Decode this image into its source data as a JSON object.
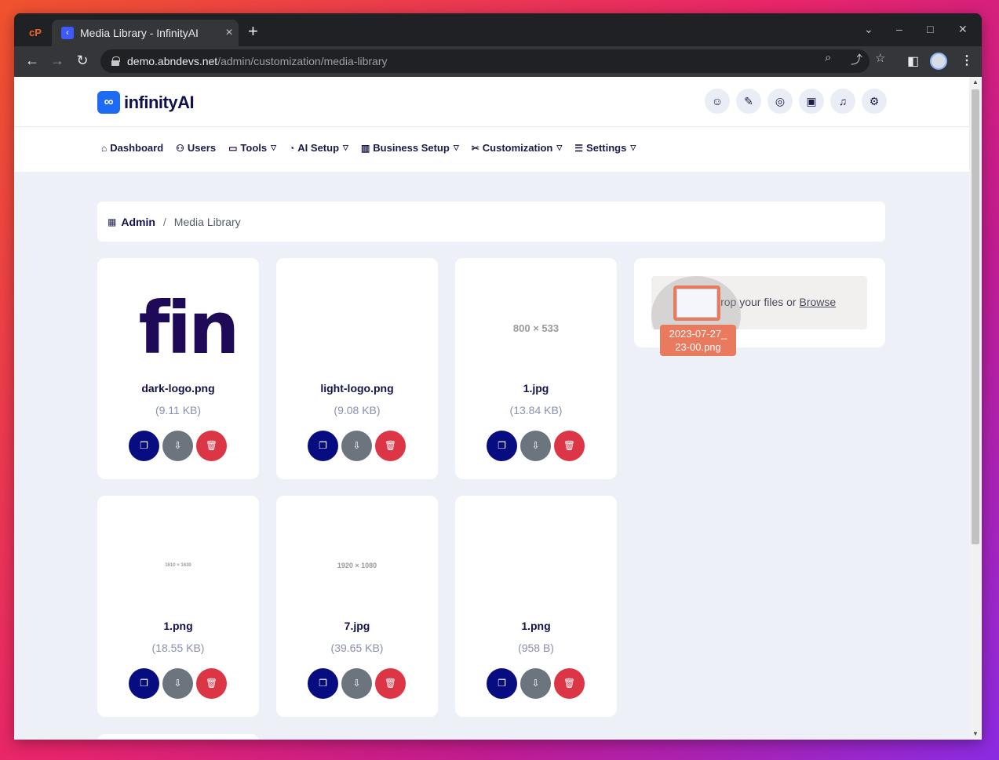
{
  "browser": {
    "tab_title": "Media Library - InfinityAI",
    "url_host": "demo.abndevs.net",
    "url_path": "/admin/customization/media-library"
  },
  "site": {
    "brand": "infinityAI",
    "header_icons": [
      "user-icon",
      "brush-icon",
      "globe-icon",
      "id-card-icon",
      "bell-icon",
      "user-settings-icon"
    ]
  },
  "nav": {
    "items": [
      {
        "label": "Dashboard",
        "icon": "home-icon",
        "dropdown": false
      },
      {
        "label": "Users",
        "icon": "users-icon",
        "dropdown": false
      },
      {
        "label": "Tools",
        "icon": "briefcase-icon",
        "dropdown": true
      },
      {
        "label": "AI Setup",
        "icon": "gauge-icon",
        "dropdown": true
      },
      {
        "label": "Business Setup",
        "icon": "building-icon",
        "dropdown": true
      },
      {
        "label": "Customization",
        "icon": "tools-icon",
        "dropdown": true
      },
      {
        "label": "Settings",
        "icon": "sliders-icon",
        "dropdown": true
      }
    ]
  },
  "breadcrumb": {
    "root": "Admin",
    "separator": "/",
    "current": "Media Library"
  },
  "media": [
    {
      "name": "dark-logo.png",
      "size": "(9.11 KB)",
      "preview": "fin"
    },
    {
      "name": "light-logo.png",
      "size": "(9.08 KB)",
      "preview": ""
    },
    {
      "name": "1.jpg",
      "size": "(13.84 KB)",
      "preview": "800 × 533"
    },
    {
      "name": "1.png",
      "size": "(18.55 KB)",
      "preview": "1610 × 1630"
    },
    {
      "name": "7.jpg",
      "size": "(39.65 KB)",
      "preview": "1920 × 1080"
    },
    {
      "name": "1.png",
      "size": "(958 B)",
      "preview": ""
    }
  ],
  "upload": {
    "drop_text": "Drop your files or",
    "browse_label": "Browse",
    "drag_file_line1": "2023-07-27_",
    "drag_file_line2": "23-00.png"
  }
}
